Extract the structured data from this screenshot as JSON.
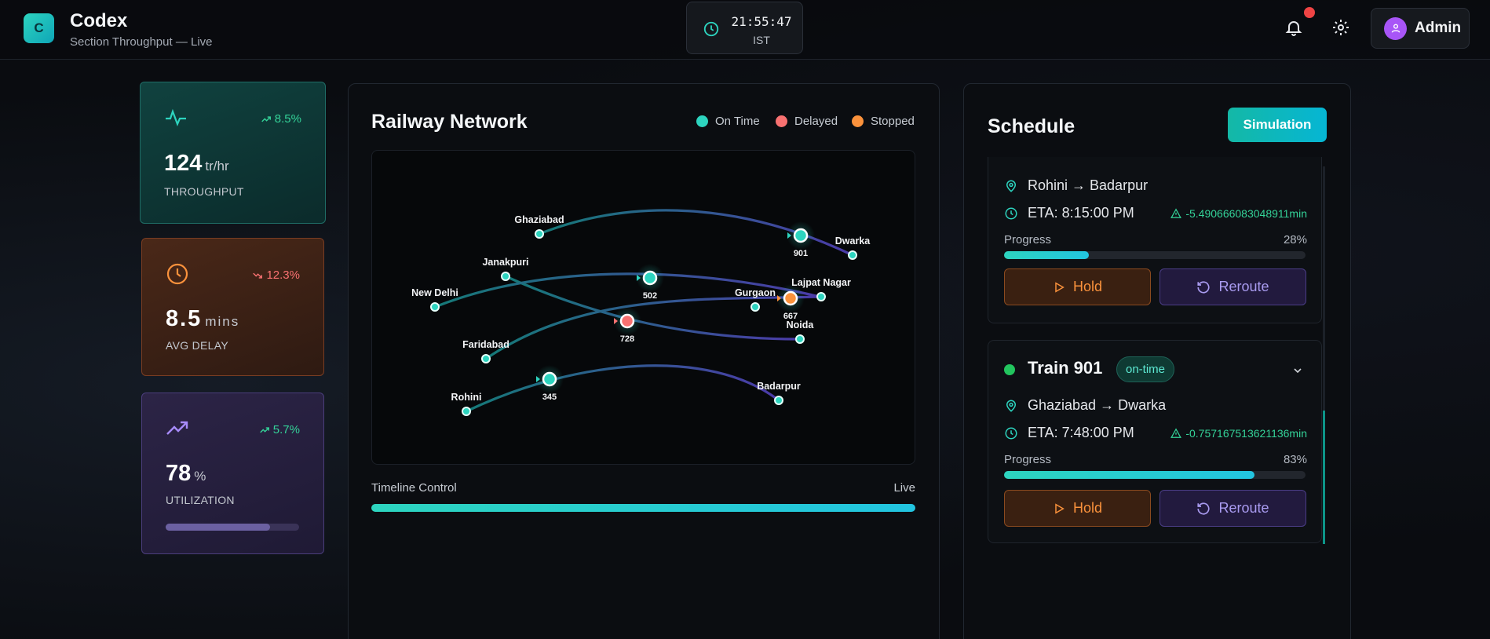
{
  "header": {
    "logo_letter": "C",
    "title": "Codex",
    "subtitle": "Section Throughput — Live",
    "clock_time": "21:55:47",
    "clock_tz": "IST",
    "user_name": "Admin",
    "icons": {
      "clock": "clock-icon",
      "notifications": "bell-icon",
      "settings": "gear-icon",
      "user": "user-icon"
    }
  },
  "stats": [
    {
      "label": "THROUGHPUT",
      "value": "124",
      "unit": "tr/hr",
      "trend": "8.5%",
      "trend_dir": "up",
      "trend_color": "#34d399",
      "icon": "activity-icon"
    },
    {
      "label": "AVG DELAY",
      "value": "8.5",
      "unit": "mins",
      "trend": "12.3%",
      "trend_dir": "down",
      "trend_color": "#f87171",
      "icon": "clock-icon"
    },
    {
      "label": "UTILIZATION",
      "value": "78",
      "unit": "%",
      "trend": "5.7%",
      "trend_dir": "up",
      "trend_color": "#34d399",
      "icon": "trending-up-icon",
      "progress": 0.78
    }
  ],
  "network": {
    "title": "Railway Network",
    "legend": [
      {
        "label": "On Time",
        "color": "#2dd4bf"
      },
      {
        "label": "Delayed",
        "color": "#f87171"
      },
      {
        "label": "Stopped",
        "color": "#fb923c"
      }
    ],
    "stations": [
      "Ghaziabad",
      "Dwarka",
      "Janakpuri",
      "New Delhi",
      "Gurgaon",
      "Lajpat Nagar",
      "Noida",
      "Faridabad",
      "Rohini",
      "Badarpur"
    ],
    "trains": [
      {
        "id": "901",
        "status": "on-time"
      },
      {
        "id": "667",
        "status": "stopped"
      },
      {
        "id": "502",
        "status": "on-time"
      },
      {
        "id": "728",
        "status": "delayed"
      },
      {
        "id": "345",
        "status": "on-time"
      }
    ],
    "timeline_label": "Timeline Control",
    "timeline_status": "Live",
    "timeline_progress": 1.0
  },
  "schedule": {
    "title": "Schedule",
    "simulation_label": "Simulation",
    "cards": [
      {
        "route": "Rohini → Badarpur",
        "eta": "ETA: 8:15:00 PM",
        "diff": "-5.490666083048911min",
        "progress_label": "Progress",
        "progress_text": "28%",
        "progress": 0.28,
        "hold": "Hold",
        "reroute": "Reroute"
      },
      {
        "train": "Train 901",
        "status": "on-time",
        "route": "Ghaziabad → Dwarka",
        "eta": "ETA: 7:48:00 PM",
        "diff": "-0.757167513621136min",
        "progress_label": "Progress",
        "progress_text": "83%",
        "progress": 0.83,
        "hold": "Hold",
        "reroute": "Reroute"
      }
    ]
  }
}
